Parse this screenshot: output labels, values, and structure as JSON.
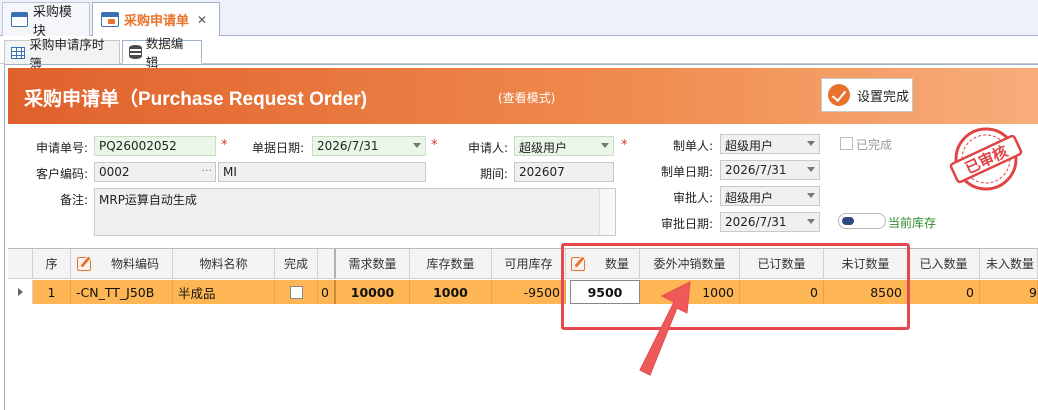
{
  "doc_tabs": [
    {
      "label": "采购模块",
      "active": false,
      "icon": "window-icon"
    },
    {
      "label": "采购申请单",
      "active": true,
      "icon": "window-icon",
      "closable": true
    }
  ],
  "sub_tabs": [
    {
      "label": "采购申请序时簿",
      "icon": "grid-icon"
    },
    {
      "label": "数据编辑",
      "icon": "database-icon",
      "active": true
    }
  ],
  "header": {
    "title": "采购申请单（Purchase Request Order)",
    "mode": "(查看模式)",
    "done_button": "设置完成",
    "accent": "#e0612b"
  },
  "form": {
    "order_no_label": "申请单号:",
    "order_no": "PQ26002052",
    "bill_date_label": "单据日期:",
    "bill_date": "2026/7/31",
    "applicant_label": "申请人:",
    "applicant": "超级用户",
    "customer_code_label": "客户编码:",
    "customer_code": "0002",
    "customer_name": "MI",
    "period_label": "期间:",
    "period": "202607",
    "remark_label": "备注:",
    "remark": "MRP运算自动生成",
    "maker_label": "制单人:",
    "maker": "超级用户",
    "make_date_label": "制单日期:",
    "make_date": "2026/7/31",
    "approver_label": "审批人:",
    "approver": "超级用户",
    "approve_date_label": "审批日期:",
    "approve_date": "2026/7/31",
    "completed_label": "已完成",
    "current_stock_label": "当前库存",
    "stamp_text": "已审核",
    "required_marker": "*"
  },
  "grid": {
    "columns": [
      "序",
      "物料编码",
      "物料名称",
      "完成",
      "需求数量",
      "库存数量",
      "可用库存",
      "数量",
      "委外冲销数量",
      "已订数量",
      "未订数量",
      "已入数量",
      "未入数量"
    ],
    "rows": [
      {
        "seq": "1",
        "material_code": "-CN_TT_J50B",
        "material_name": "半成品",
        "done": false,
        "sep": "0",
        "demand_qty": "10000",
        "stock_qty": "1000",
        "available_stock": "-9500",
        "qty": "9500",
        "outsource_offset_qty": "1000",
        "ordered_qty": "0",
        "unordered_qty": "8500",
        "received_qty": "0",
        "unreceived_qty": "9"
      }
    ]
  },
  "colors": {
    "highlight_row": "#fdb653",
    "annotation": "#e5484d"
  }
}
